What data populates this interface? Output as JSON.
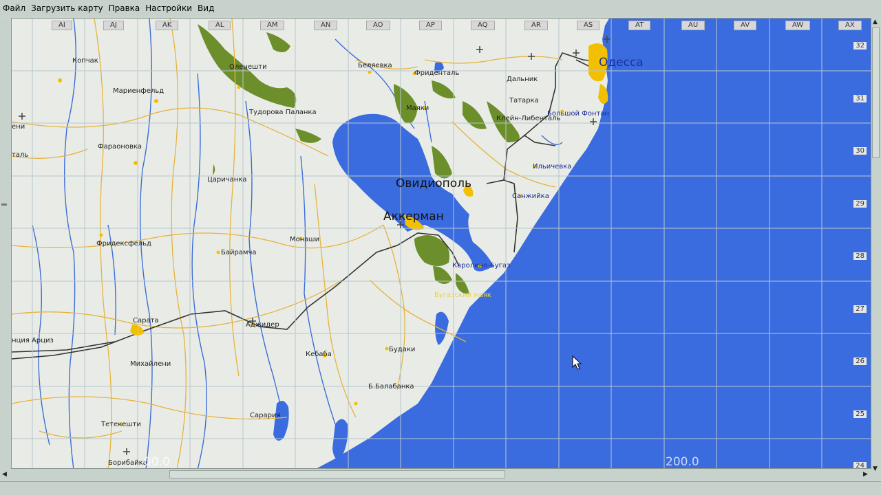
{
  "menu": [
    "Файл",
    "Загрузить карту",
    "Правка",
    "Настройки",
    "Вид"
  ],
  "grid_columns": [
    "AI",
    "AJ",
    "AK",
    "AL",
    "AM",
    "AN",
    "AO",
    "AP",
    "AQ",
    "AR",
    "AS",
    "AT",
    "AU",
    "AV",
    "AW",
    "AX"
  ],
  "grid_rows": [
    "32",
    "31",
    "30",
    "29",
    "28",
    "27",
    "26",
    "25",
    "24"
  ],
  "places": {
    "odessa": "Одесса",
    "ovidiopol": "Овидиополь",
    "akkerman": "Аккерман",
    "kopchak": "Копчак",
    "marienfeld": "Мариенфельд",
    "oleneshti": "Оленешти",
    "tudorova": "Тудорова Паланка",
    "faraonovka": "Фараоновка",
    "tsarichanka": "Царичанка",
    "fridexfeld": "Фридексфельд",
    "bairamcha": "Байрамча",
    "monashi": "Монаши",
    "sarata": "Сарата",
    "mihaileni": "Михайлени",
    "tetekeshti": "Тетекешти",
    "boribayka": "Борибайка",
    "adjder": "Аджидер",
    "kebaba": "Кебаба",
    "budaki": "Будаки",
    "b_balabanka": "Б.Балабанка",
    "sararia": "Сарария",
    "belyaevka": "Беляевка",
    "fridental": "Фриденталь",
    "mayaki": "Маяки",
    "dalnik": "Дальник",
    "tatarka": "Татарка",
    "klein_libental": "Клейн-Либенталь",
    "bolshoy_fontan": "Большой Фонтан",
    "ilyichevka": "Ильичевка",
    "sanzhiyka": "Санжийка",
    "karolino": "Каролино-Бугаз",
    "bugaz_mayak": "Бугазский маяк",
    "kantsiya": "нция Арциз",
    "edge_eni": "ени",
    "edge_tal": "таль"
  },
  "scale_labels": [
    "200.0",
    "00.0"
  ],
  "colors": {
    "sea": "#3a6cdf",
    "land": "#e9ece6",
    "forest": "#6c8f2c",
    "road_major": "#e6b23c",
    "railway": "#333333",
    "town": "#f2c000",
    "grid": "#b8c6cf"
  }
}
